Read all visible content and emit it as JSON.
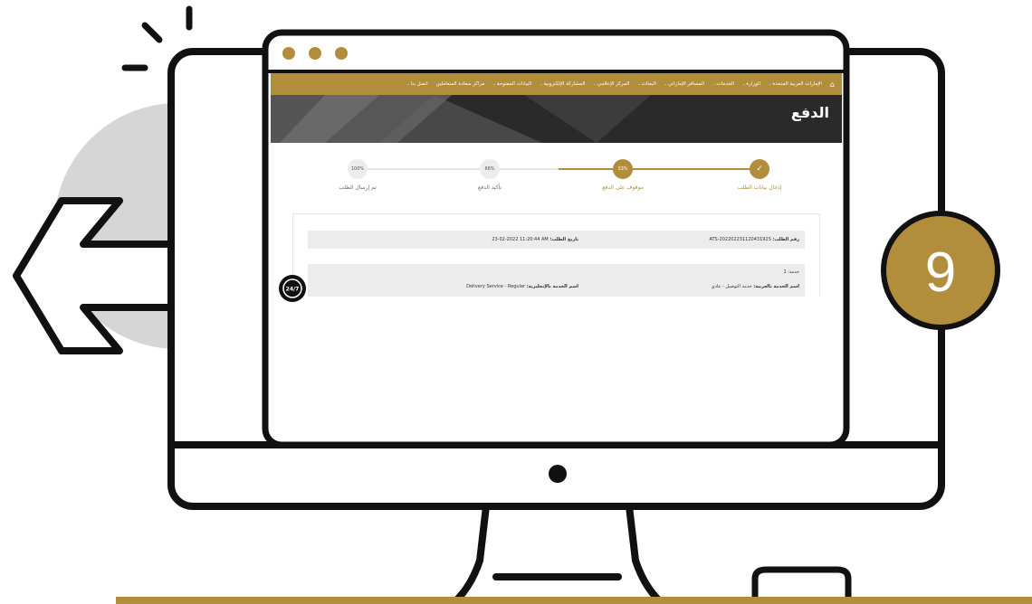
{
  "badge": {
    "number": "9"
  },
  "nav": {
    "home_icon": "home-icon",
    "items": [
      {
        "label": "الإمارات العربية المتحدة",
        "has_menu": true
      },
      {
        "label": "الوزارة",
        "has_menu": true
      },
      {
        "label": "الخدمات",
        "has_menu": true
      },
      {
        "label": "المسافر الإماراتي",
        "has_menu": true
      },
      {
        "label": "البعثات",
        "has_menu": true
      },
      {
        "label": "المركز الإعلامي",
        "has_menu": true
      },
      {
        "label": "المشاركة الإلكترونية",
        "has_menu": true
      },
      {
        "label": "البيانات المفتوحة",
        "has_menu": true
      },
      {
        "label": "مراكز سعادة المتعاملين",
        "has_menu": false
      },
      {
        "label": "اتصل بنا",
        "has_menu": true
      }
    ]
  },
  "page": {
    "title": "الدفع"
  },
  "steps": [
    {
      "label": "إدخال بيانات الطلب",
      "value": "✓",
      "status": "done"
    },
    {
      "label": "موقوف على الدفع",
      "value": "33%",
      "status": "current"
    },
    {
      "label": "تأكيد الدفع",
      "value": "66%",
      "status": "pending"
    },
    {
      "label": "تم إرسال الطلب",
      "value": "100%",
      "status": "pending"
    }
  ],
  "request": {
    "number_label": "رقم الطلب:",
    "number_value": "ATS-20220223112043192S",
    "date_label": "تاريخ الطلب:",
    "date_value": "23-02-2022 11:20:44 AM"
  },
  "service": {
    "header": "خدمة: 1",
    "ar_name_label": "اسم الخدمة بالعربية:",
    "ar_name_value": "خدمة التوصيل - عادي",
    "en_name_label": "اسم الخدمة بالإنجليزية:",
    "en_name_value": "Delivery Service - Regular"
  },
  "chat_widget": {
    "label": "24/7",
    "icon": "chat-support-icon"
  },
  "colors": {
    "gold": "#b28d3c",
    "outline": "#111111",
    "hero": "#2a2a2a",
    "gray": "#d6d6d6"
  }
}
